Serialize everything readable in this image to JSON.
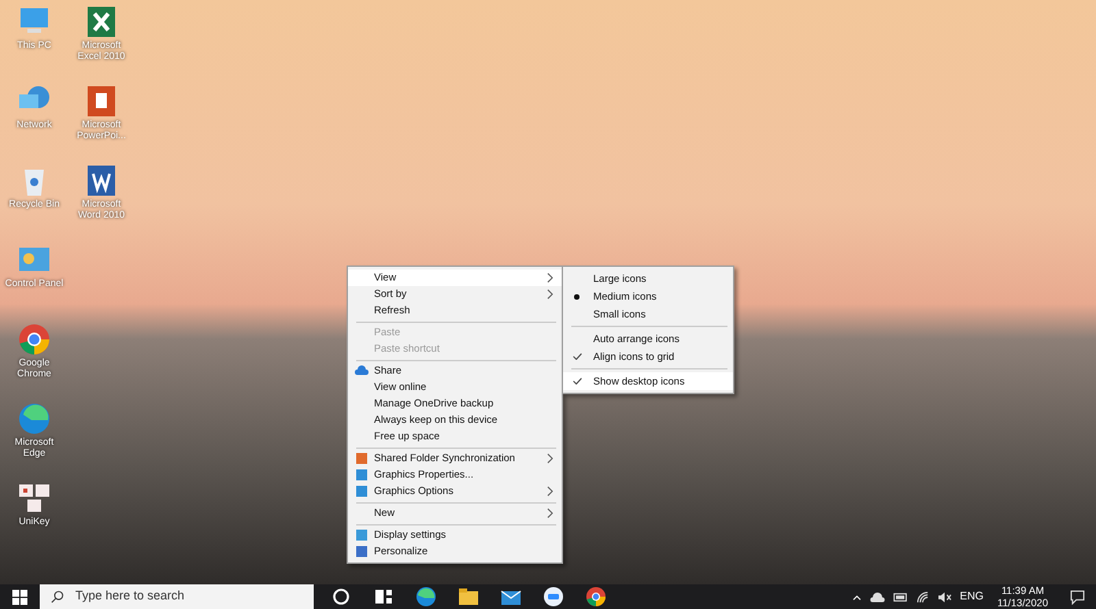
{
  "desktop_icons": [
    {
      "label": "This PC",
      "kind": "pc"
    },
    {
      "label": "Network",
      "kind": "network"
    },
    {
      "label": "Recycle Bin",
      "kind": "bin"
    },
    {
      "label": "Control Panel",
      "kind": "control"
    },
    {
      "label": "Google Chrome",
      "kind": "chrome"
    },
    {
      "label": "Microsoft Edge",
      "kind": "edge"
    },
    {
      "label": "UniKey",
      "kind": "unikey"
    },
    {
      "label": "Microsoft Excel 2010",
      "kind": "excel"
    },
    {
      "label": "Microsoft PowerPoi...",
      "kind": "powerpoint"
    },
    {
      "label": "Microsoft Word 2010",
      "kind": "word"
    }
  ],
  "context_menu": {
    "items": [
      {
        "kind": "item",
        "label": "View",
        "submenu": true,
        "selected": true,
        "disabled": false
      },
      {
        "kind": "item",
        "label": "Sort by",
        "submenu": true,
        "selected": false,
        "disabled": false
      },
      {
        "kind": "item",
        "label": "Refresh",
        "submenu": false,
        "selected": false,
        "disabled": false
      },
      {
        "kind": "separator"
      },
      {
        "kind": "item",
        "label": "Paste",
        "submenu": false,
        "selected": false,
        "disabled": true
      },
      {
        "kind": "item",
        "label": "Paste shortcut",
        "submenu": false,
        "selected": false,
        "disabled": true
      },
      {
        "kind": "separator"
      },
      {
        "kind": "item",
        "label": "Share",
        "submenu": false,
        "selected": false,
        "disabled": false
      },
      {
        "kind": "item",
        "label": "View online",
        "submenu": false,
        "selected": false,
        "disabled": false
      },
      {
        "kind": "item",
        "label": "Manage OneDrive backup",
        "submenu": false,
        "selected": false,
        "disabled": false
      },
      {
        "kind": "item",
        "label": "Always keep on this device",
        "submenu": false,
        "selected": false,
        "disabled": false
      },
      {
        "kind": "item",
        "label": "Free up space",
        "submenu": false,
        "selected": false,
        "disabled": false
      },
      {
        "kind": "separator"
      },
      {
        "kind": "item",
        "label": "Shared Folder Synchronization",
        "submenu": true,
        "selected": false,
        "disabled": false
      },
      {
        "kind": "item",
        "label": "Graphics Properties...",
        "submenu": false,
        "selected": false,
        "disabled": false
      },
      {
        "kind": "item",
        "label": "Graphics Options",
        "submenu": true,
        "selected": false,
        "disabled": false
      },
      {
        "kind": "separator"
      },
      {
        "kind": "item",
        "label": "New",
        "submenu": true,
        "selected": false,
        "disabled": false
      },
      {
        "kind": "separator"
      },
      {
        "kind": "item",
        "label": "Display settings",
        "submenu": false,
        "selected": false,
        "disabled": false
      },
      {
        "kind": "item",
        "label": "Personalize",
        "submenu": false,
        "selected": false,
        "disabled": false
      }
    ]
  },
  "view_submenu": {
    "items": [
      {
        "kind": "radio",
        "label": "Large icons",
        "checked": false,
        "selected": false
      },
      {
        "kind": "radio",
        "label": "Medium icons",
        "checked": true,
        "selected": false
      },
      {
        "kind": "radio",
        "label": "Small icons",
        "checked": false,
        "selected": false
      },
      {
        "kind": "separator"
      },
      {
        "kind": "check",
        "label": "Auto arrange icons",
        "checked": false,
        "selected": false
      },
      {
        "kind": "check",
        "label": "Align icons to grid",
        "checked": true,
        "selected": false
      },
      {
        "kind": "separator"
      },
      {
        "kind": "check",
        "label": "Show desktop icons",
        "checked": true,
        "selected": true
      }
    ]
  },
  "taskbar": {
    "search": {
      "placeholder": "Type here to search"
    },
    "tray": {
      "language": "ENG",
      "time": "11:39 AM",
      "date": "11/13/2020"
    }
  }
}
